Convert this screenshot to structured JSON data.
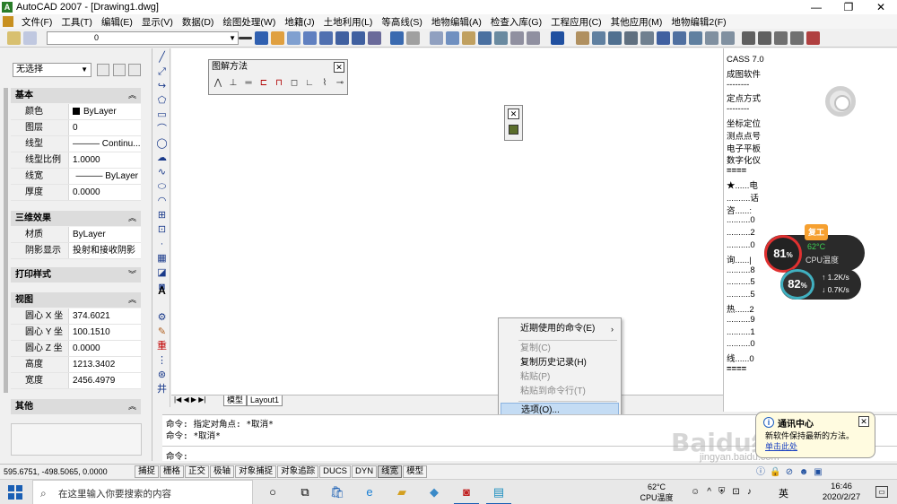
{
  "window": {
    "title": "AutoCAD 2007 - [Drawing1.dwg]",
    "app_icon": "A",
    "min": "—",
    "restore": "❐",
    "close": "✕"
  },
  "menu": [
    "文件(F)",
    "工具(T)",
    "编辑(E)",
    "显示(V)",
    "数据(D)",
    "绘图处理(W)",
    "地籍(J)",
    "土地利用(L)",
    "等高线(S)",
    "地物编辑(A)",
    "检查入库(G)",
    "工程应用(C)",
    "其他应用(M)",
    "地物编辑2(F)"
  ],
  "layer": {
    "value": "0"
  },
  "properties": {
    "selection": "无选择",
    "sections": {
      "basic": "基本",
      "three_d": "三维效果",
      "print": "打印样式",
      "view": "视图",
      "other": "其他"
    },
    "basic_rows": [
      {
        "key": "颜色",
        "value": "ByLayer"
      },
      {
        "key": "图层",
        "value": "0"
      },
      {
        "key": "线型",
        "value": "——— Continu..."
      },
      {
        "key": "线型比例",
        "value": "1.0000"
      },
      {
        "key": "线宽",
        "value": "——— ByLayer"
      },
      {
        "key": "厚度",
        "value": "0.0000"
      }
    ],
    "three_d_rows": [
      {
        "key": "材质",
        "value": "ByLayer"
      },
      {
        "key": "阴影显示",
        "value": "投射和接收阴影"
      }
    ],
    "view_rows": [
      {
        "key": "圆心 X 坐标",
        "value": "374.6021"
      },
      {
        "key": "圆心 Y 坐标",
        "value": "100.1510"
      },
      {
        "key": "圆心 Z 坐标",
        "value": "0.0000"
      },
      {
        "key": "高度",
        "value": "1213.3402"
      },
      {
        "key": "宽度",
        "value": "2456.4979"
      }
    ]
  },
  "float_toolbar": {
    "title": "图解方法",
    "close": "✕"
  },
  "mini_toolbar": {
    "close": "✕"
  },
  "context_menu": {
    "recent": "近期使用的命令(E)",
    "copy": "复制(C)",
    "copy_history": "复制历史记录(H)",
    "paste": "粘贴(P)",
    "paste_cmd": "粘贴到命令行(T)",
    "options": "选项(O)..."
  },
  "layout_tabs": {
    "nav": "|◀ ◀ ▶ ▶|",
    "model": "模型",
    "layout1": "Layout1"
  },
  "cass_panel": [
    "CASS 7.0",
    "成图软件",
    "--------",
    "定点方式",
    "--------",
    "坐标定位",
    "测点点号",
    "电子平板",
    "数字化仪",
    "====",
    "★......电",
    "..........话",
    "咨......:",
    "..........0",
    "..........2",
    "..........0",
    "询......|",
    "..........8",
    "..........5",
    "..........5",
    "热......2",
    "..........9",
    "..........1",
    "..........0",
    "线......0",
    "===="
  ],
  "cpu_widget": {
    "badge": "复工",
    "cpu_pct": "81",
    "pct_unit": "%",
    "cpu_temp": "62°C",
    "cpu_temp_label": "CPU温度",
    "mem_pct": "82",
    "upload": "1.2K/s",
    "download": "0.7K/s"
  },
  "command_line": {
    "line1": "命令: 指定对角点: *取消*",
    "line2": "命令: *取消*",
    "prompt": "命令:"
  },
  "notification": {
    "title": "通讯中心",
    "close": "✕",
    "message": "新软件保持最新的方法。",
    "link": "单击此处"
  },
  "status": {
    "coords": "595.6751,  -498.5065, 0.0000",
    "buttons": [
      "捕捉",
      "栅格",
      "正交",
      "极轴",
      "对象捕捉",
      "对象追踪",
      "DUCS",
      "DYN",
      "线宽",
      "模型"
    ]
  },
  "taskbar": {
    "search_placeholder": "在这里输入你要搜索的内容",
    "cpu_temp": "62°C",
    "cpu_label": "CPU温度",
    "ime": "英",
    "time": "16:46",
    "date": "2020/2/27"
  },
  "watermark": {
    "text": "Baidu经验",
    "url": "jingyan.baidu.com"
  },
  "colors": {
    "accent": "#1a5fb4",
    "highlight": "#c4dcf4",
    "cpu_red": "#e03030",
    "cpu_green": "#3fd050"
  }
}
